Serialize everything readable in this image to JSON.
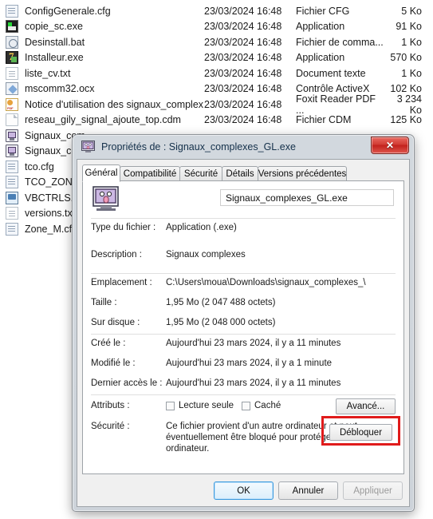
{
  "file_list": {
    "rows": [
      {
        "icon": "cfg-file-icon",
        "name": "ConfigGenerale.cfg",
        "date": "23/03/2024 16:48",
        "type": "Fichier CFG",
        "size": "5 Ko"
      },
      {
        "icon": "application-icon",
        "name": "copie_sc.exe",
        "date": "23/03/2024 16:48",
        "type": "Application",
        "size": "91 Ko"
      },
      {
        "icon": "batch-file-icon",
        "name": "Desinstall.bat",
        "date": "23/03/2024 16:48",
        "type": "Fichier de comma...",
        "size": "1 Ko"
      },
      {
        "icon": "sevenzip-archive-icon",
        "name": "Installeur.exe",
        "date": "23/03/2024 16:48",
        "type": "Application",
        "size": "570 Ko"
      },
      {
        "icon": "text-document-icon",
        "name": "liste_cv.txt",
        "date": "23/03/2024 16:48",
        "type": "Document texte",
        "size": "1 Ko"
      },
      {
        "icon": "activex-control-icon",
        "name": "mscomm32.ocx",
        "date": "23/03/2024 16:48",
        "type": "Contrôle ActiveX",
        "size": "102 Ko"
      },
      {
        "icon": "pdf-document-icon",
        "name": "Notice d'utilisation des signaux_complex...",
        "date": "23/03/2024 16:48",
        "type": "Foxit Reader PDF ...",
        "size": "3 234 Ko"
      },
      {
        "icon": "cdm-file-icon",
        "name": "reseau_gily_signal_ajoute_top.cdm",
        "date": "23/03/2024 16:48",
        "type": "Fichier CDM",
        "size": "125 Ko"
      },
      {
        "icon": "monitor-app-icon",
        "name": "Signaux_com",
        "date": "",
        "type": "",
        "size": ""
      },
      {
        "icon": "monitor-app-icon",
        "name": "Signaux_com",
        "date": "",
        "type": "",
        "size": ""
      },
      {
        "icon": "cfg-file-icon",
        "name": "tco.cfg",
        "date": "",
        "type": "",
        "size": ""
      },
      {
        "icon": "cfg-file-icon",
        "name": "TCO_ZONEM",
        "date": "",
        "type": "",
        "size": ""
      },
      {
        "icon": "registry-file-icon",
        "name": "VBCTRLS.RE",
        "date": "",
        "type": "",
        "size": ""
      },
      {
        "icon": "text-document-icon",
        "name": "versions.txt",
        "date": "",
        "type": "",
        "size": ""
      },
      {
        "icon": "cfg-file-icon",
        "name": "Zone_M.cfg",
        "date": "",
        "type": "",
        "size": ""
      }
    ]
  },
  "dialog": {
    "title": "Propriétés de : Signaux_complexes_GL.exe",
    "close_label": "✕",
    "tabs": [
      {
        "label": "Général",
        "active": true
      },
      {
        "label": "Compatibilité",
        "active": false
      },
      {
        "label": "Sécurité",
        "active": false
      },
      {
        "label": "Détails",
        "active": false
      },
      {
        "label": "Versions précédentes",
        "active": false
      }
    ],
    "file_name": "Signaux_complexes_GL.exe",
    "properties": [
      {
        "label": "Type du fichier :",
        "value": "Application (.exe)"
      },
      {
        "label": "Description :",
        "value": "Signaux complexes"
      }
    ],
    "location": [
      {
        "label": "Emplacement :",
        "value": "C:\\Users\\moua\\Downloads\\signaux_complexes_\\"
      },
      {
        "label": "Taille :",
        "value": "1,95 Mo (2 047 488 octets)"
      },
      {
        "label": "Sur disque :",
        "value": "1,95 Mo (2 048 000 octets)"
      }
    ],
    "dates": [
      {
        "label": "Créé le :",
        "value": "Aujourd'hui 23 mars 2024, il y a 11 minutes"
      },
      {
        "label": "Modifié le :",
        "value": "Aujourd'hui 23 mars 2024, il y a 1 minute"
      },
      {
        "label": "Dernier accès le :",
        "value": "Aujourd'hui 23 mars 2024, il y a 11 minutes"
      }
    ],
    "attributes": {
      "label": "Attributs :",
      "read_only_label": "Lecture seule",
      "hidden_label": "Caché",
      "advanced_label": "Avancé..."
    },
    "security": {
      "label": "Sécurité :",
      "text_line1": "Ce fichier provient d'un autre ordinateur et peut",
      "text_line2": "éventuellement être bloqué pour protéger cet ordinateur.",
      "unblock_label": "Débloquer",
      "highlight_color": "#e01b1b"
    },
    "footer": {
      "ok_label": "OK",
      "cancel_label": "Annuler",
      "apply_label": "Appliquer"
    }
  }
}
